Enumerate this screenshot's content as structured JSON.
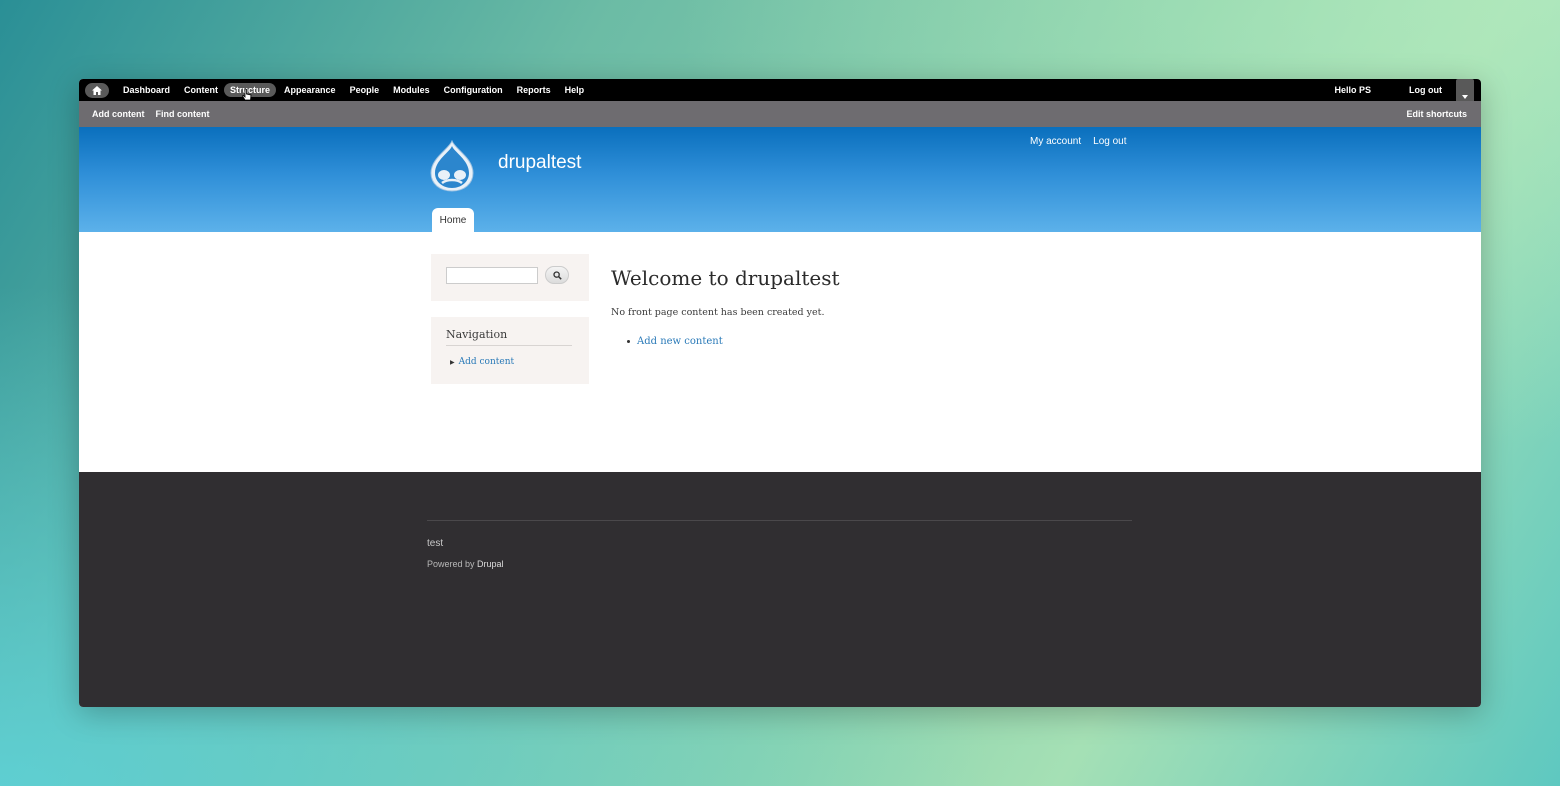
{
  "toolbar": {
    "items": [
      {
        "label": "Dashboard",
        "active": false
      },
      {
        "label": "Content",
        "active": false
      },
      {
        "label": "Structure",
        "active": true
      },
      {
        "label": "Appearance",
        "active": false
      },
      {
        "label": "People",
        "active": false
      },
      {
        "label": "Modules",
        "active": false
      },
      {
        "label": "Configuration",
        "active": false
      },
      {
        "label": "Reports",
        "active": false
      },
      {
        "label": "Help",
        "active": false
      }
    ],
    "user_greeting": "Hello PS",
    "logout": "Log out"
  },
  "shortcuts": {
    "items": [
      "Add content",
      "Find content"
    ],
    "edit": "Edit shortcuts"
  },
  "header": {
    "site_name": "drupaltest",
    "secondary_menu": [
      "My account",
      "Log out"
    ],
    "tab_home": "Home"
  },
  "sidebar": {
    "search_value": "",
    "navigation_title": "Navigation",
    "navigation_items": [
      "Add content"
    ]
  },
  "content": {
    "title": "Welcome to drupaltest",
    "message": "No front page content has been created yet.",
    "link": "Add new content"
  },
  "footer": {
    "text": "test",
    "powered_prefix": "Powered by",
    "powered_link": "Drupal"
  },
  "colors": {
    "accent_blue": "#2a7ab8",
    "header_blue": "#2f8fd8",
    "footer_bg": "#302e31"
  }
}
